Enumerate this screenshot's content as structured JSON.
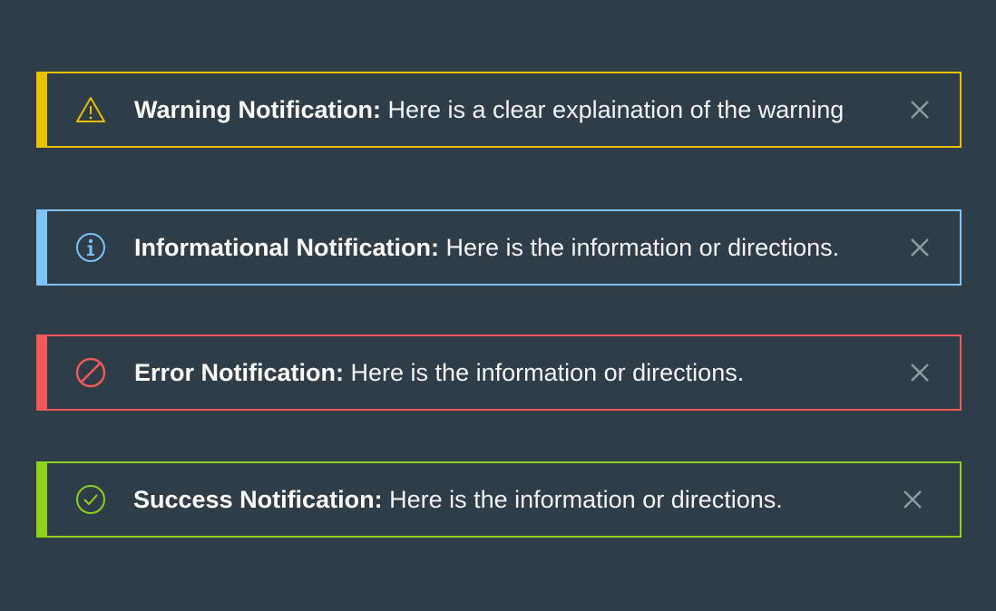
{
  "notifications": [
    {
      "type": "warning",
      "icon": "warning-triangle-icon",
      "color": "#e8c100",
      "title": "Warning Notification:",
      "message": "Here is a clear explaination of the warning"
    },
    {
      "type": "info",
      "icon": "info-circle-icon",
      "color": "#7cc4fa",
      "title": "Informational Notification:",
      "message": "Here is the information or directions."
    },
    {
      "type": "error",
      "icon": "error-prohibited-icon",
      "color": "#f05a5a",
      "title": "Error Notification:",
      "message": "Here is the information or directions."
    },
    {
      "type": "success",
      "icon": "success-check-circle-icon",
      "color": "#8fd11c",
      "title": "Success Notification:",
      "message": "Here is the information or directions."
    }
  ],
  "close_icon": "close-icon",
  "close_icon_color": "#8d9ba3",
  "background_color": "#2e3d47"
}
